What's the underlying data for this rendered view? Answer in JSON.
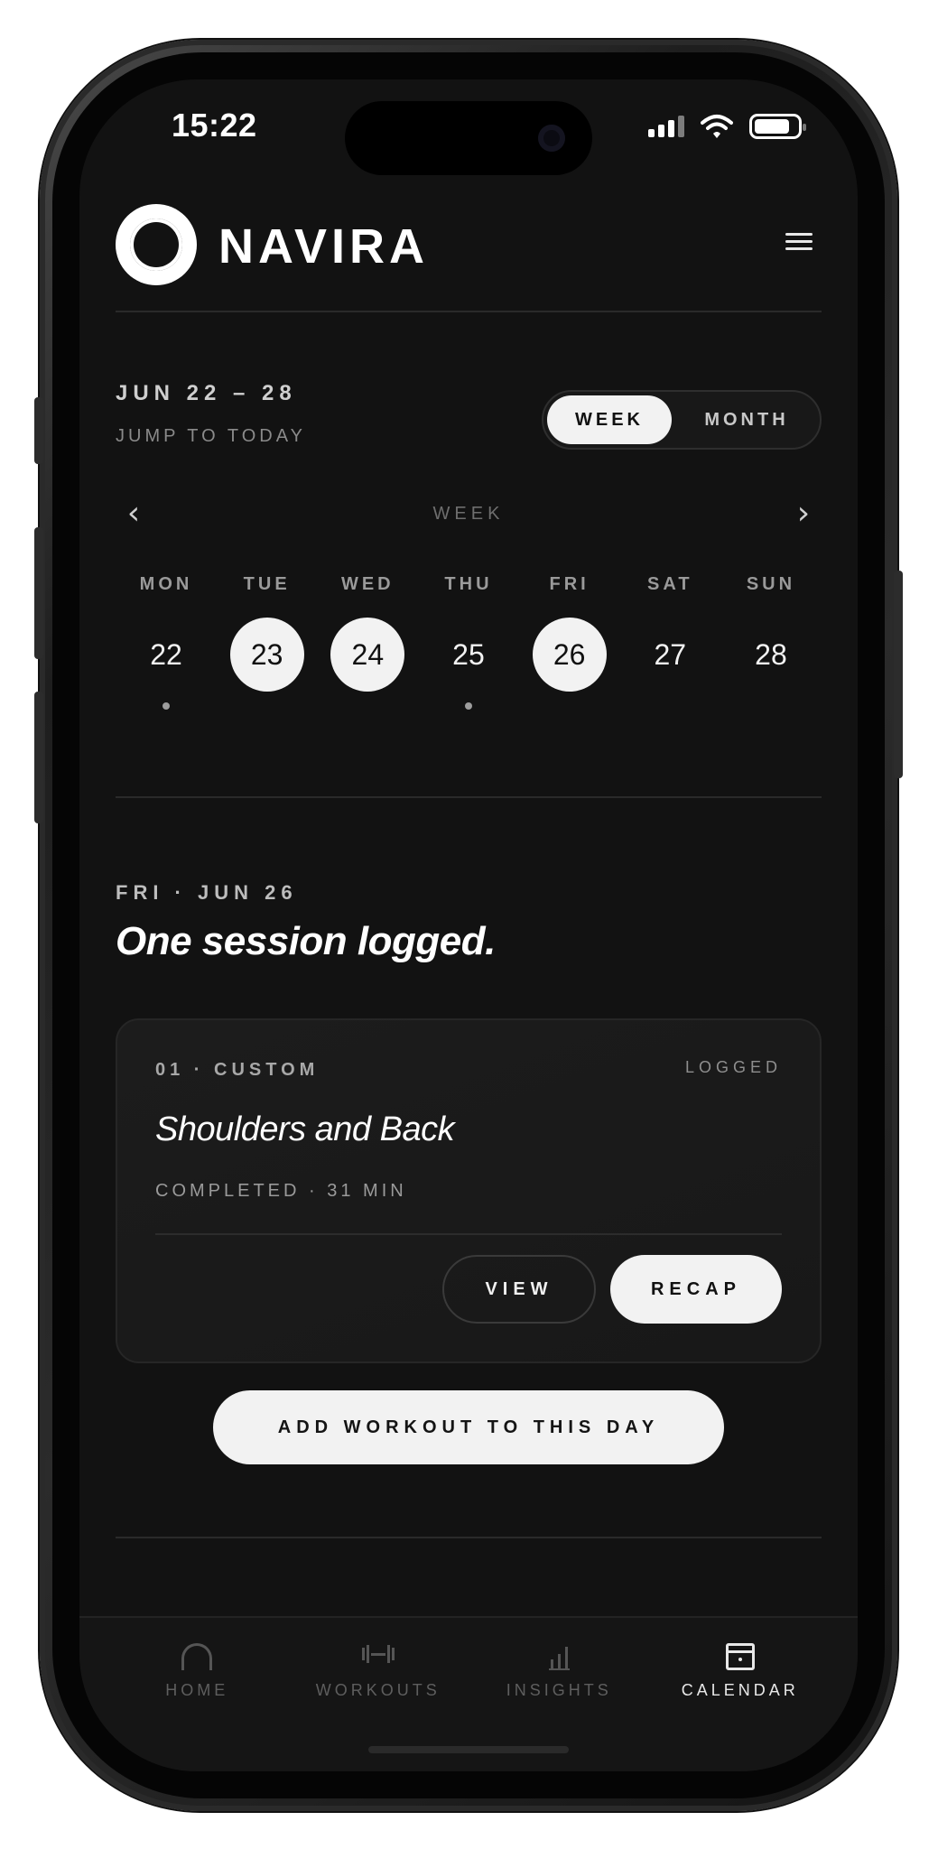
{
  "status_bar": {
    "time": "15:22"
  },
  "header": {
    "brand": "NAVIRA"
  },
  "range": {
    "label": "JUN 22 – 28",
    "jump_link": "JUMP TO TODAY"
  },
  "view_toggle": {
    "week": "WEEK",
    "month": "MONTH",
    "selected": "WEEK"
  },
  "week_nav": {
    "caption": "WEEK"
  },
  "days": [
    {
      "name": "MON",
      "num": "22",
      "filled": false,
      "dot": true
    },
    {
      "name": "TUE",
      "num": "23",
      "filled": true,
      "dot": false
    },
    {
      "name": "WED",
      "num": "24",
      "filled": true,
      "dot": false
    },
    {
      "name": "THU",
      "num": "25",
      "filled": false,
      "dot": true
    },
    {
      "name": "FRI",
      "num": "26",
      "filled": true,
      "dot": false
    },
    {
      "name": "SAT",
      "num": "27",
      "filled": false,
      "dot": false
    },
    {
      "name": "SUN",
      "num": "28",
      "filled": false,
      "dot": false
    }
  ],
  "selected_day": {
    "label": "FRI · JUN 26",
    "headline": "One session logged."
  },
  "session": {
    "tag": "01 · CUSTOM",
    "status": "LOGGED",
    "title": "Shoulders and Back",
    "meta": "COMPLETED · 31 MIN",
    "view_label": "VIEW",
    "recap_label": "RECAP"
  },
  "add_button": "ADD WORKOUT TO THIS DAY",
  "tabbar": [
    {
      "label": "HOME",
      "icon": "home-arch-icon",
      "active": false
    },
    {
      "label": "WORKOUTS",
      "icon": "dumbbell-icon",
      "active": false
    },
    {
      "label": "INSIGHTS",
      "icon": "bar-chart-icon",
      "active": false
    },
    {
      "label": "CALENDAR",
      "icon": "calendar-icon",
      "active": true
    }
  ],
  "colors": {
    "background": "#121212",
    "accent": "#f2f2f2",
    "muted": "#8a8a8a"
  }
}
